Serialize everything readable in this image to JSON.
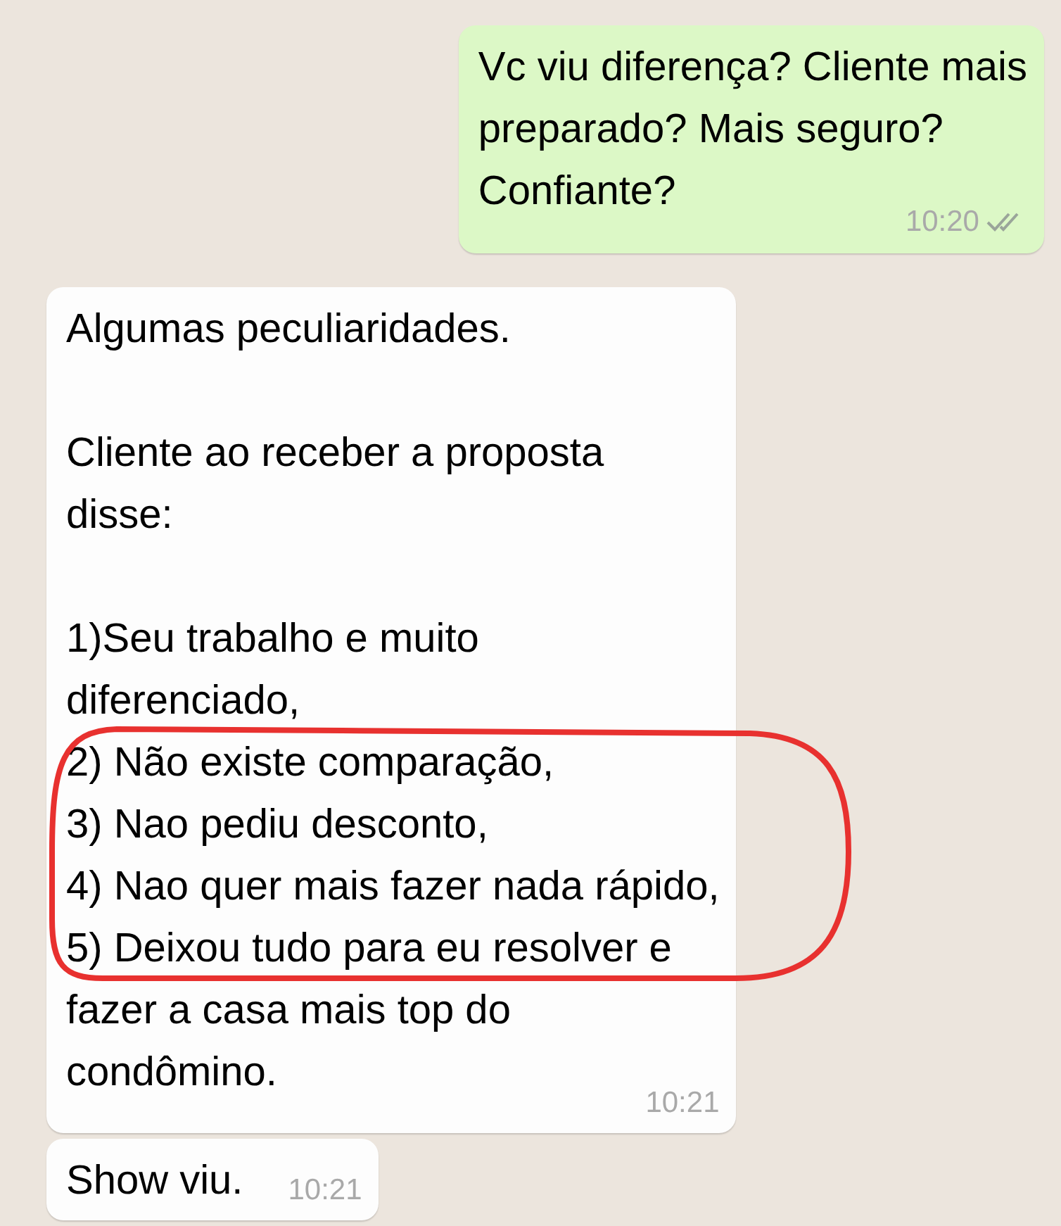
{
  "messages": [
    {
      "kind": "outgoing",
      "time": "10:20",
      "paragraphs": [
        [
          "Vc viu diferença? Cliente mais",
          "preparado? Mais seguro?",
          "Confiante?"
        ]
      ]
    },
    {
      "kind": "incoming",
      "time": "10:21",
      "paragraphs": [
        [
          "Algumas peculiaridades."
        ],
        [
          "Cliente ao receber a proposta",
          "disse:"
        ],
        [
          "1)Seu trabalho e muito",
          "diferenciado,",
          "2) Não existe comparação,",
          "3) Nao pediu desconto,",
          "4) Nao quer mais fazer nada rápido,",
          "5) Deixou tudo para eu resolver e",
          "fazer a casa mais top do",
          "condômino."
        ]
      ]
    },
    {
      "kind": "incoming",
      "time": "10:21",
      "paragraphs": [
        [
          "Show viu."
        ]
      ]
    }
  ]
}
